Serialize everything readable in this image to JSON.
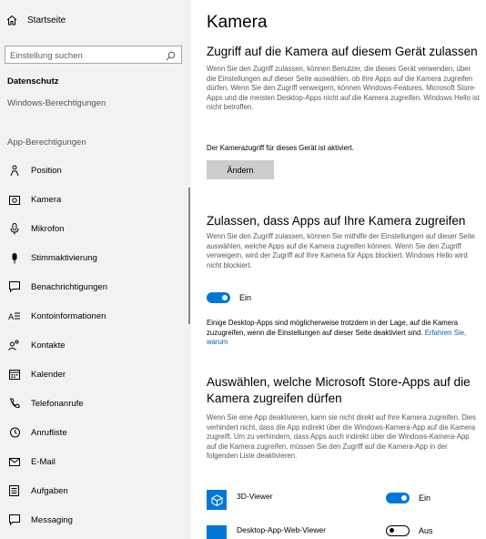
{
  "sidebar": {
    "home_label": "Startseite",
    "search_placeholder": "Einstellung suchen",
    "section_privacy": "Datenschutz",
    "windows_permissions": "Windows-Berechtigungen",
    "app_permissions": "App-Berechtigungen",
    "items": [
      {
        "label": "Position",
        "icon": "person-location-icon"
      },
      {
        "label": "Kamera",
        "icon": "camera-icon"
      },
      {
        "label": "Mikrofon",
        "icon": "microphone-icon"
      },
      {
        "label": "Stimmaktivierung",
        "icon": "voice-icon"
      },
      {
        "label": "Benachrichtigungen",
        "icon": "notification-icon"
      },
      {
        "label": "Kontoinformationen",
        "icon": "account-info-icon"
      },
      {
        "label": "Kontakte",
        "icon": "contacts-icon"
      },
      {
        "label": "Kalender",
        "icon": "calendar-icon"
      },
      {
        "label": "Telefonanrufe",
        "icon": "phone-icon"
      },
      {
        "label": "Anrufliste",
        "icon": "history-icon"
      },
      {
        "label": "E-Mail",
        "icon": "mail-icon"
      },
      {
        "label": "Aufgaben",
        "icon": "tasks-icon"
      },
      {
        "label": "Messaging",
        "icon": "messaging-icon"
      }
    ]
  },
  "main": {
    "title": "Kamera",
    "section1": {
      "heading": "Zugriff auf die Kamera auf diesem Gerät zulassen",
      "text": "Wenn Sie den Zugriff zulassen, können Benutzer, die dieses Gerät verwenden, über die Einstellungen auf dieser Seite auswählen, ob ihre Apps auf die Kamera zugreifen dürfen. Wenn Sie den Zugriff verweigern, können Windows-Features, Microsoft Store-Apps und die meisten Desktop-Apps nicht auf die Kamera zugreifen. Windows Hello ist nicht betroffen.",
      "status": "Der Kamerazugriff für dieses Gerät ist aktiviert.",
      "button": "Ändern"
    },
    "section2": {
      "heading": "Zulassen, dass Apps auf Ihre Kamera zugreifen",
      "text": "Wenn Sie den Zugriff zulassen, können Sie mithilfe der Einstellungen auf dieser Seite auswählen, welche Apps auf die Kamera zugreifen können. Wenn Sie den Zugriff verweigern, wird der Zugriff auf Ihre Kamera für Apps blockiert. Windows Hello wird nicht blockiert.",
      "toggle_label": "Ein",
      "desktop_note": "Einige Desktop-Apps sind möglicherweise trotzdem in der Lage, auf die Kamera zuzugreifen, wenn die Einstellungen auf dieser Seite deaktiviert sind.",
      "learn_more": "Erfahren Sie, warum"
    },
    "section3": {
      "heading": "Auswählen, welche Microsoft Store-Apps auf die Kamera zugreifen dürfen",
      "text": "Wenn Sie eine App deaktivieren, kann sie nicht direkt auf Ihre Kamera zugreifen. Dies verhindert nicht, dass die App indirekt über die Windows-Kamera-App auf die Kamera zugreift. Um zu verhindern, dass Apps auch indirekt über die Windows-Kamera-App auf die Kamera zugreifen, müssen Sie den Zugriff auf die Kamera-App in der folgenden Liste deaktivieren.",
      "apps": [
        {
          "name": "3D-Viewer",
          "toggle": "Ein",
          "on": true,
          "icon": "cube-icon"
        },
        {
          "name": "Desktop-App-Web-Viewer",
          "toggle": "Aus",
          "on": false,
          "icon": "app-tile-icon"
        }
      ]
    }
  },
  "colors": {
    "accent": "#0078d7",
    "sidebar_bg": "#f2f2f2",
    "link": "#0063b1"
  }
}
